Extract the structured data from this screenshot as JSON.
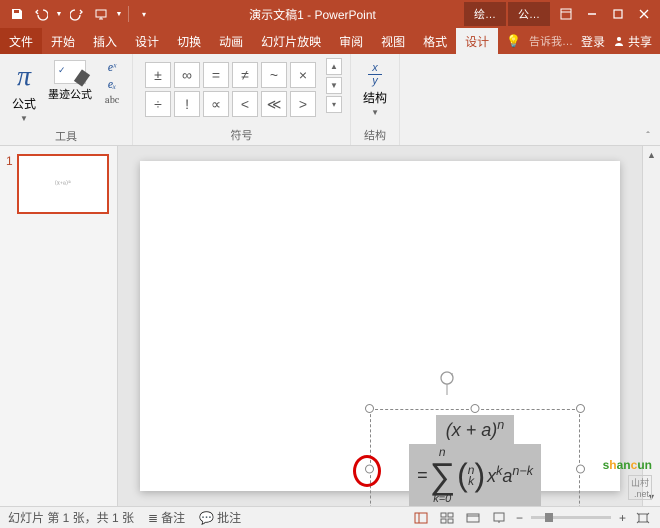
{
  "titlebar": {
    "title": "演示文稿1 - PowerPoint",
    "ctx_tab1": "绘…",
    "ctx_tab2": "公…"
  },
  "tabs": {
    "file": "文件",
    "home": "开始",
    "insert": "插入",
    "design": "设计",
    "transitions": "切换",
    "animations": "动画",
    "slideshow": "幻灯片放映",
    "review": "审阅",
    "view": "视图",
    "format": "格式",
    "eq_design": "设计",
    "tell_me": "告诉我…",
    "signin": "登录",
    "share": "共享"
  },
  "ribbon": {
    "equation_label": "公式",
    "ink_label": "墨迹公式",
    "tools_group": "工具",
    "symbols_group": "符号",
    "structures_group": "结构",
    "structure_btn": "结构",
    "ex_sup": "eˣ",
    "ex_sub": "eₓ",
    "abc": "abc",
    "sym": {
      "r1": [
        "±",
        "∞",
        "=",
        "≠",
        "~",
        "×"
      ],
      "r2": [
        "÷",
        "!",
        "∝",
        "<",
        "≪",
        ">"
      ]
    }
  },
  "slides": {
    "current_num": "1",
    "thumb_preview": "(x+a)ⁿ"
  },
  "equation": {
    "top": "(x + a)<sup>n</sup>",
    "prefix": "=",
    "sigma_top": "n",
    "sigma_bot": "k=0",
    "binom_top": "n",
    "binom_bot": "k",
    "tail": " x<sup>k</sup>a<sup>n−k</sup>"
  },
  "statusbar": {
    "slide_info": "幻灯片 第 1 张，共 1 张",
    "notes": "备注",
    "comments": "批注",
    "zoom_out": "−",
    "zoom_in": "+"
  },
  "watermark": {
    "text": "shancun",
    "sub": "山村\n.net"
  }
}
